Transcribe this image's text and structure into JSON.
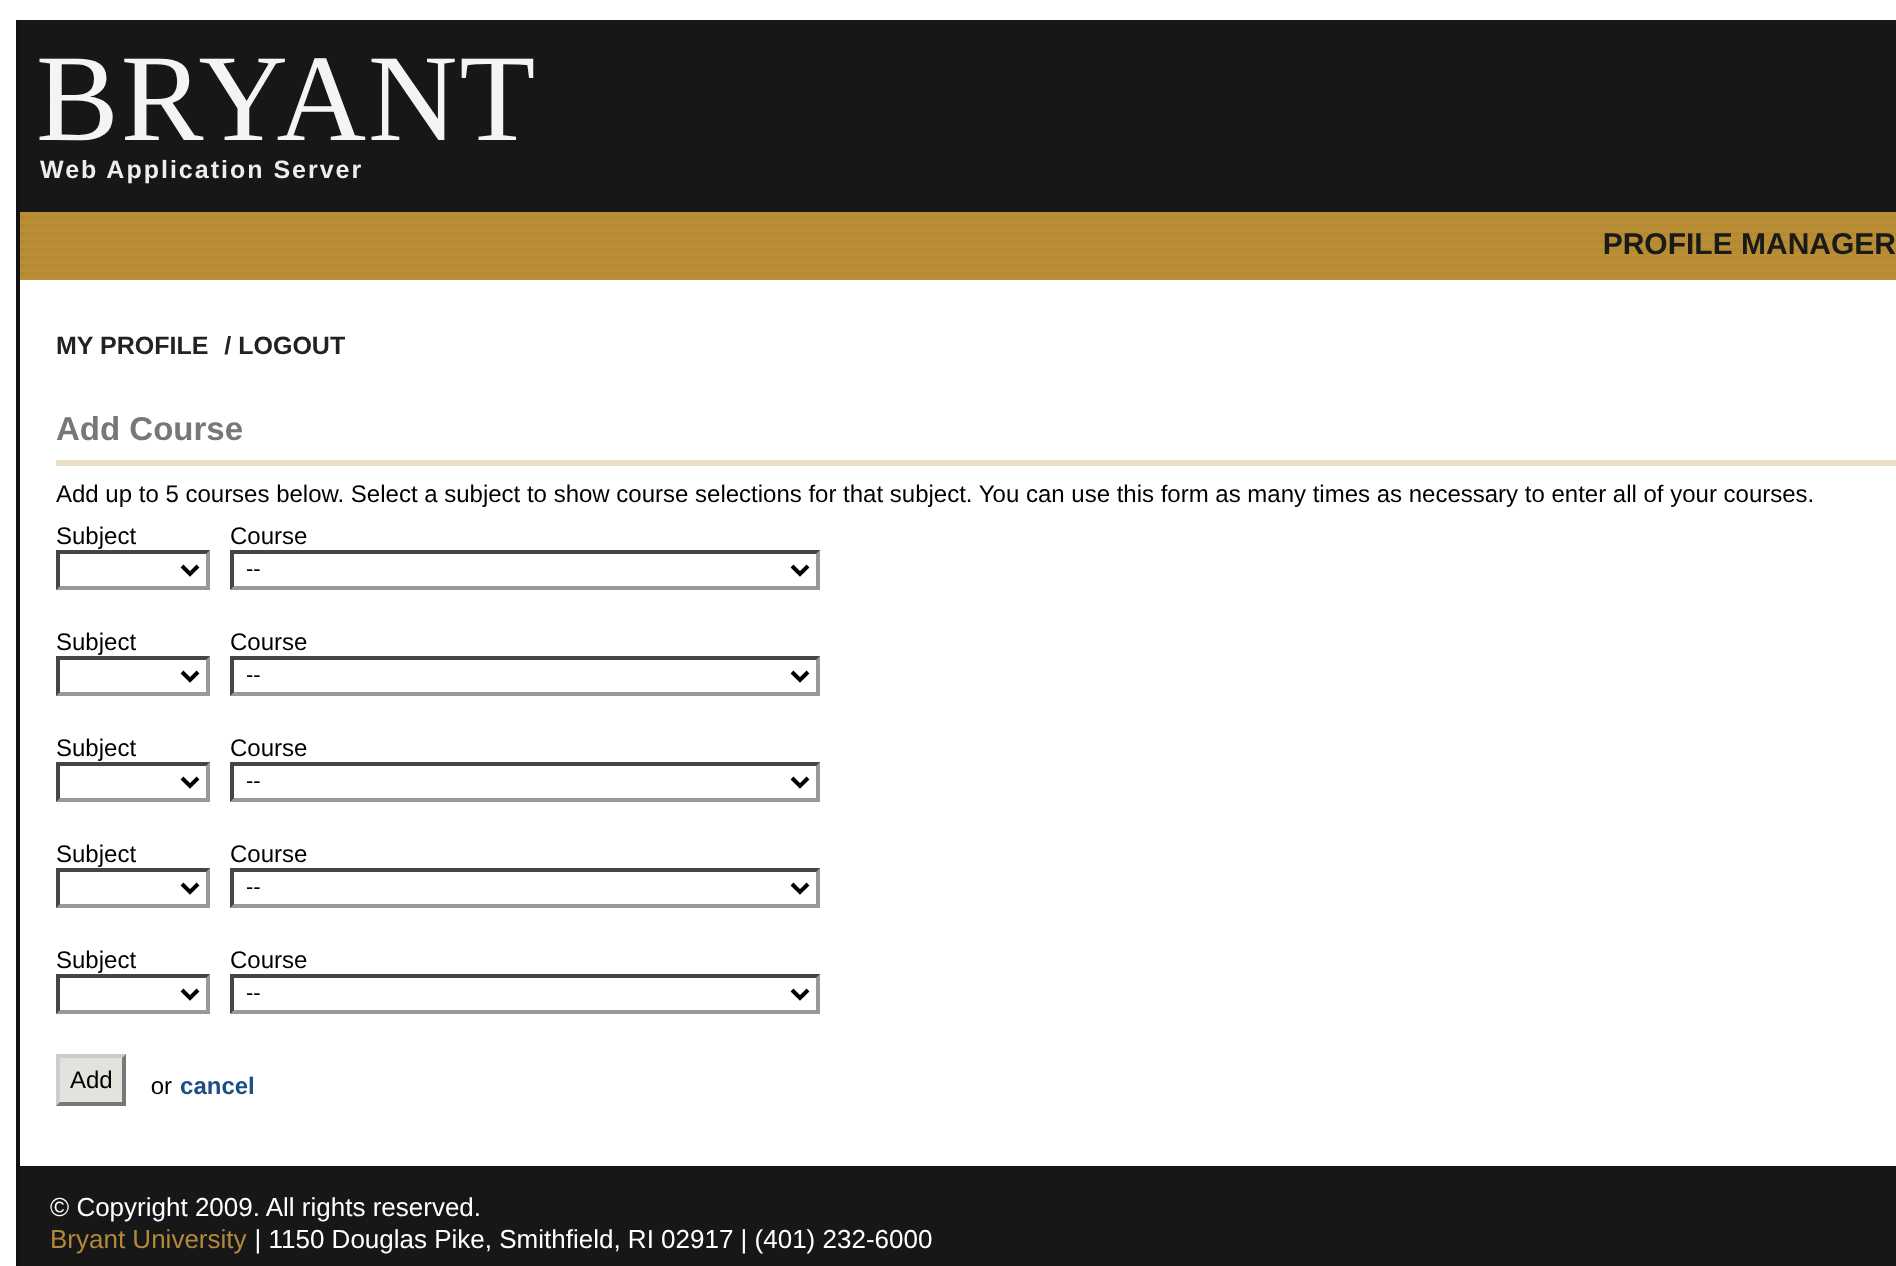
{
  "header": {
    "logo": "BRYANT",
    "subtitle": "Web Application Server"
  },
  "banner": {
    "title": "PROFILE MANAGER"
  },
  "nav": [
    {
      "label": "MY PROFILE"
    },
    {
      "label": "/ LOGOUT"
    }
  ],
  "heading": "Add Course",
  "intro": "Add up to 5 courses below. Select a subject to show course selections for that subject. You can use this form as many times as necessary to enter all of your courses.",
  "course_rows": [
    {
      "subject_label": "Subject",
      "course_label": "Course",
      "course_value": "--"
    },
    {
      "subject_label": "Subject",
      "course_label": "Course",
      "course_value": "--"
    },
    {
      "subject_label": "Subject",
      "course_label": "Course",
      "course_value": "--"
    },
    {
      "subject_label": "Subject",
      "course_label": "Course",
      "course_value": "--"
    },
    {
      "subject_label": "Subject",
      "course_label": "Course",
      "course_value": "--"
    }
  ],
  "actions": {
    "button": "Add",
    "or_text": "or",
    "cancel_link": "cancel"
  },
  "footer": {
    "copyright": "© Copyright 2009. All rights reserved.",
    "org_link": "Bryant University",
    "address": "| 1150 Douglas Pike, Smithfield, RI 02917 | (401) 232-6000"
  }
}
